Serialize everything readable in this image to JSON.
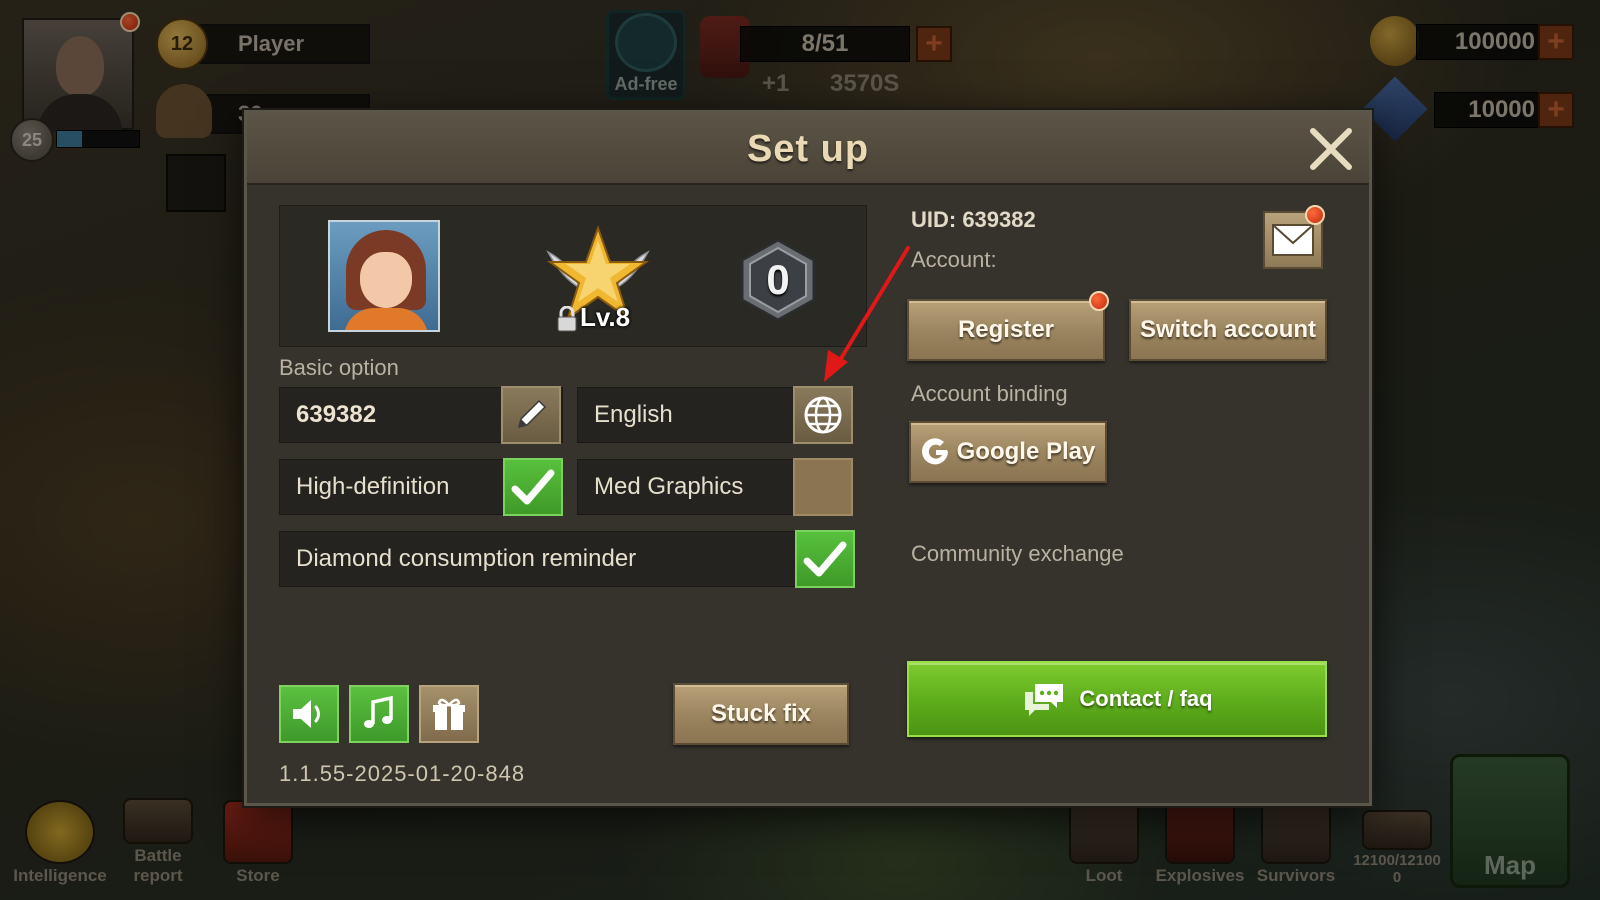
{
  "hud": {
    "player_name": "Player",
    "player_level": "12",
    "commander_level": "25",
    "troops": "30",
    "ad_free_label": "Ad-free",
    "energy": "8/51",
    "energy_regen": "+1",
    "energy_timer": "3570S",
    "gold": "100000",
    "diamonds": "10000",
    "plus_symbol": "+"
  },
  "bottom_bar": {
    "intelligence": "Intelligence",
    "battle_report_line1": "Battle",
    "battle_report_line2": "report",
    "store": "Store",
    "loot": "Loot",
    "explosives": "Explosives",
    "survivors": "Survivors",
    "storage_line1": "12100/12100",
    "storage_line2": "0",
    "map": "Map"
  },
  "dialog": {
    "title": "Set up",
    "profile": {
      "rank_level": "Lv.8",
      "badge_number": "0"
    },
    "basic_option_label": "Basic option",
    "name_value": "639382",
    "language_value": "English",
    "hd_label": "High-definition",
    "hd_checked": true,
    "graphics_label": "Med Graphics",
    "graphics_checked": false,
    "diamond_reminder_label": "Diamond consumption reminder",
    "diamond_reminder_checked": true,
    "stuck_fix_label": "Stuck fix",
    "version": "1.1.55-2025-01-20-848",
    "uid_text": "UID: 639382",
    "account_label": "Account:",
    "register_label": "Register",
    "switch_account_label": "Switch account",
    "account_binding_label": "Account binding",
    "google_play_label": "Google Play",
    "community_label": "Community exchange",
    "contact_label": "Contact / faq"
  },
  "colors": {
    "accent_green": "#5fae1c",
    "notification_red": "#e0441c",
    "annotation_arrow": "#e01818"
  },
  "icons": [
    "close-icon",
    "pencil-icon",
    "globe-icon",
    "check-icon",
    "speaker-icon",
    "music-note-icon",
    "gift-icon",
    "mail-icon",
    "google-g-icon",
    "chat-bubble-icon",
    "lock-icon",
    "star-rank-icon",
    "hex-badge-icon"
  ]
}
